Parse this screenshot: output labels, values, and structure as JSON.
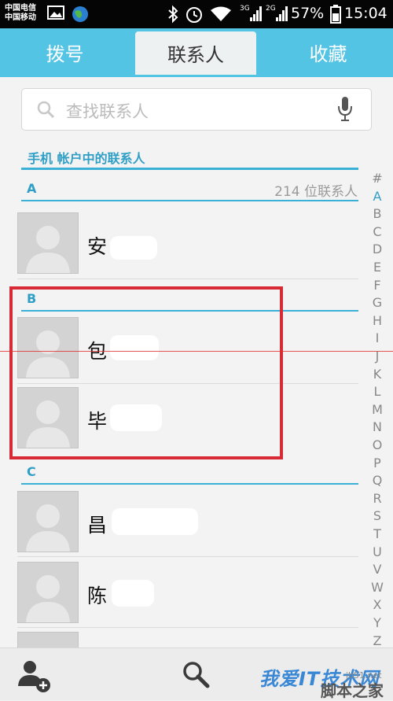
{
  "status": {
    "carrier1": "中国电信",
    "carrier2": "中国移动",
    "net1": "3G",
    "net2": "2G",
    "battery": "57%",
    "time": "15:04"
  },
  "tabs": [
    {
      "label": "拨号",
      "active": false
    },
    {
      "label": "联系人",
      "active": true
    },
    {
      "label": "收藏",
      "active": false
    }
  ],
  "search": {
    "placeholder": "查找联系人"
  },
  "section_title": "手机 帐户中的联系人",
  "contact_count": "214 位联系人",
  "groups": [
    {
      "letter": "A",
      "contacts": [
        {
          "name": "安"
        }
      ]
    },
    {
      "letter": "B",
      "contacts": [
        {
          "name": "包"
        },
        {
          "name": "毕"
        }
      ]
    },
    {
      "letter": "C",
      "contacts": [
        {
          "name": "昌"
        },
        {
          "name": "陈"
        }
      ]
    }
  ],
  "index_letters": [
    "#",
    "A",
    "B",
    "C",
    "D",
    "E",
    "F",
    "G",
    "H",
    "I",
    "J",
    "K",
    "L",
    "M",
    "N",
    "O",
    "P",
    "Q",
    "R",
    "S",
    "T",
    "U",
    "V",
    "W",
    "X",
    "Y",
    "Z"
  ],
  "index_active": "A",
  "watermark": {
    "main": "我爱IT技术网",
    "url": "jb51.net",
    "sub": "脚本之家"
  },
  "colors": {
    "accent": "#53c4e4",
    "highlight": "#d72a34"
  }
}
